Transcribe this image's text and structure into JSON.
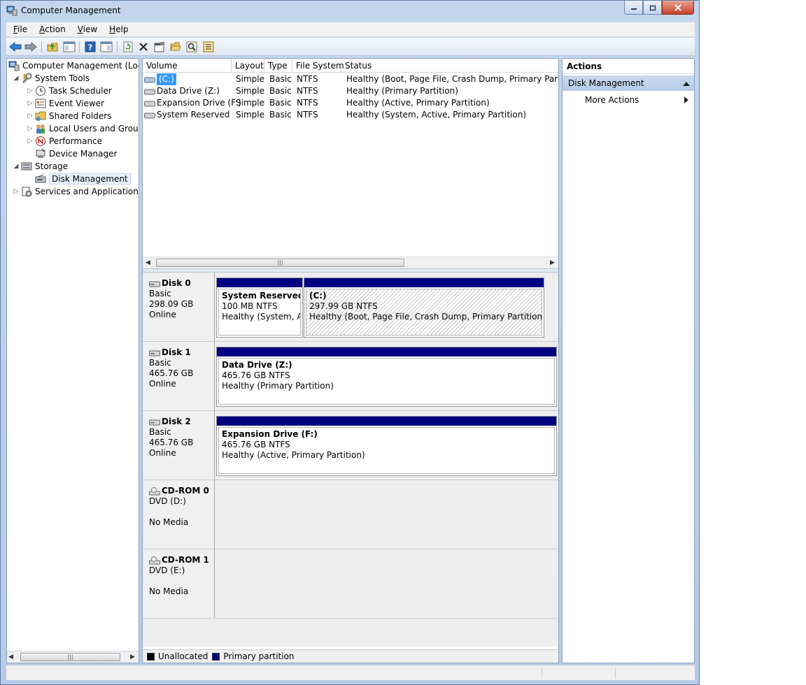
{
  "window": {
    "title": "Computer Management"
  },
  "menu": {
    "file": "ile",
    "file_key": "F",
    "action": "ction",
    "action_key": "A",
    "view": "iew",
    "view_key": "V",
    "help": "elp",
    "help_key": "H"
  },
  "tree": {
    "root": "Computer Management (Local",
    "system_tools": "System Tools",
    "task_scheduler": "Task Scheduler",
    "event_viewer": "Event Viewer",
    "shared_folders": "Shared Folders",
    "local_users": "Local Users and Groups",
    "performance": "Performance",
    "device_manager": "Device Manager",
    "storage": "Storage",
    "disk_management": "Disk Management",
    "services": "Services and Applications"
  },
  "volume_list": {
    "columns": [
      "Volume",
      "Layout",
      "Type",
      "File System",
      "Status"
    ],
    "rows": [
      {
        "volume": "(C:)",
        "layout": "Simple",
        "type": "Basic",
        "fs": "NTFS",
        "status": "Healthy (Boot, Page File, Crash Dump, Primary Partition)"
      },
      {
        "volume": "Data Drive (Z:)",
        "layout": "Simple",
        "type": "Basic",
        "fs": "NTFS",
        "status": "Healthy (Primary Partition)"
      },
      {
        "volume": "Expansion Drive (F:)",
        "layout": "Simple",
        "type": "Basic",
        "fs": "NTFS",
        "status": "Healthy (Active, Primary Partition)"
      },
      {
        "volume": "System Reserved",
        "layout": "Simple",
        "type": "Basic",
        "fs": "NTFS",
        "status": "Healthy (System, Active, Primary Partition)"
      }
    ]
  },
  "disks": [
    {
      "name": "Disk 0",
      "kind": "Basic",
      "size": "298.09 GB",
      "state": "Online",
      "partitions": [
        {
          "title": "System Reserved",
          "size": "100 MB NTFS",
          "status": "Healthy (System, Act"
        },
        {
          "title": "(C:)",
          "size": "297.99 GB NTFS",
          "status": "Healthy (Boot, Page File, Crash Dump, Primary Partition)"
        }
      ]
    },
    {
      "name": "Disk 1",
      "kind": "Basic",
      "size": "465.76 GB",
      "state": "Online",
      "partitions": [
        {
          "title": "Data Drive  (Z:)",
          "size": "465.76 GB NTFS",
          "status": "Healthy (Primary Partition)"
        }
      ]
    },
    {
      "name": "Disk 2",
      "kind": "Basic",
      "size": "465.76 GB",
      "state": "Online",
      "partitions": [
        {
          "title": "Expansion Drive  (F:)",
          "size": "465.76 GB NTFS",
          "status": "Healthy (Active, Primary Partition)"
        }
      ]
    },
    {
      "name": "CD-ROM 0",
      "kind": "DVD (D:)",
      "size": "",
      "state": "No Media",
      "partitions": []
    },
    {
      "name": "CD-ROM 1",
      "kind": "DVD (E:)",
      "size": "",
      "state": "No Media",
      "partitions": []
    }
  ],
  "legend": {
    "unallocated": "Unallocated",
    "primary": "Primary partition"
  },
  "colors": {
    "unallocated": "#000000",
    "primary": "#000080",
    "selection": "#3399ff",
    "section": "#c9d9ef"
  },
  "actions": {
    "title": "Actions",
    "section": "Disk Management",
    "more": "More Actions"
  },
  "icons": {
    "back": "back-arrow-icon",
    "forward": "forward-arrow-icon",
    "up": "up-folder-icon",
    "show_tree": "show-hide-tree-icon",
    "help": "help-icon",
    "properties_pane": "pane-icon",
    "refresh": "refresh-icon",
    "delete": "delete-icon",
    "properties": "properties-icon",
    "open": "open-folder-icon",
    "search": "magnifier-icon",
    "export": "export-icon"
  }
}
